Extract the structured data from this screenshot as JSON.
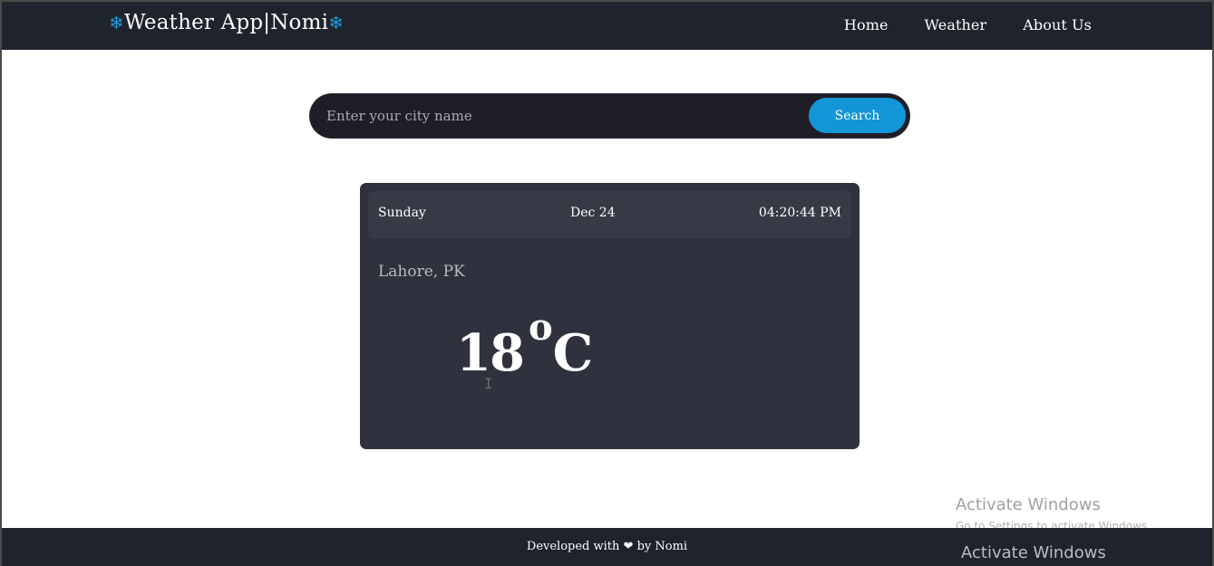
{
  "navbar": {
    "brand_text": "Weather App|Nomi",
    "flake_glyph": "❄",
    "links": [
      {
        "label": "Home"
      },
      {
        "label": "Weather"
      },
      {
        "label": "About Us"
      }
    ]
  },
  "search": {
    "placeholder": "Enter your city name",
    "value": "",
    "button_label": "Search"
  },
  "card": {
    "day": "Sunday",
    "date": "Dec 24",
    "time": "04:20:44 PM",
    "city": "Lahore, PK",
    "temperature": "18",
    "degree_symbol": "o",
    "unit": "C"
  },
  "footer": {
    "prefix": "Developed with",
    "heart": "❤",
    "suffix": "by Nomi"
  },
  "watermark": {
    "title": "Activate Windows",
    "subtitle": "Go to Settings to activate Windows.",
    "title_repeat": "Activate Windows"
  },
  "colors": {
    "navbar_bg": "#1f232b",
    "accent": "#1296d8",
    "card_bg": "#2f323d",
    "card_header_bg": "#363a45",
    "search_bg": "#1f1d26"
  }
}
